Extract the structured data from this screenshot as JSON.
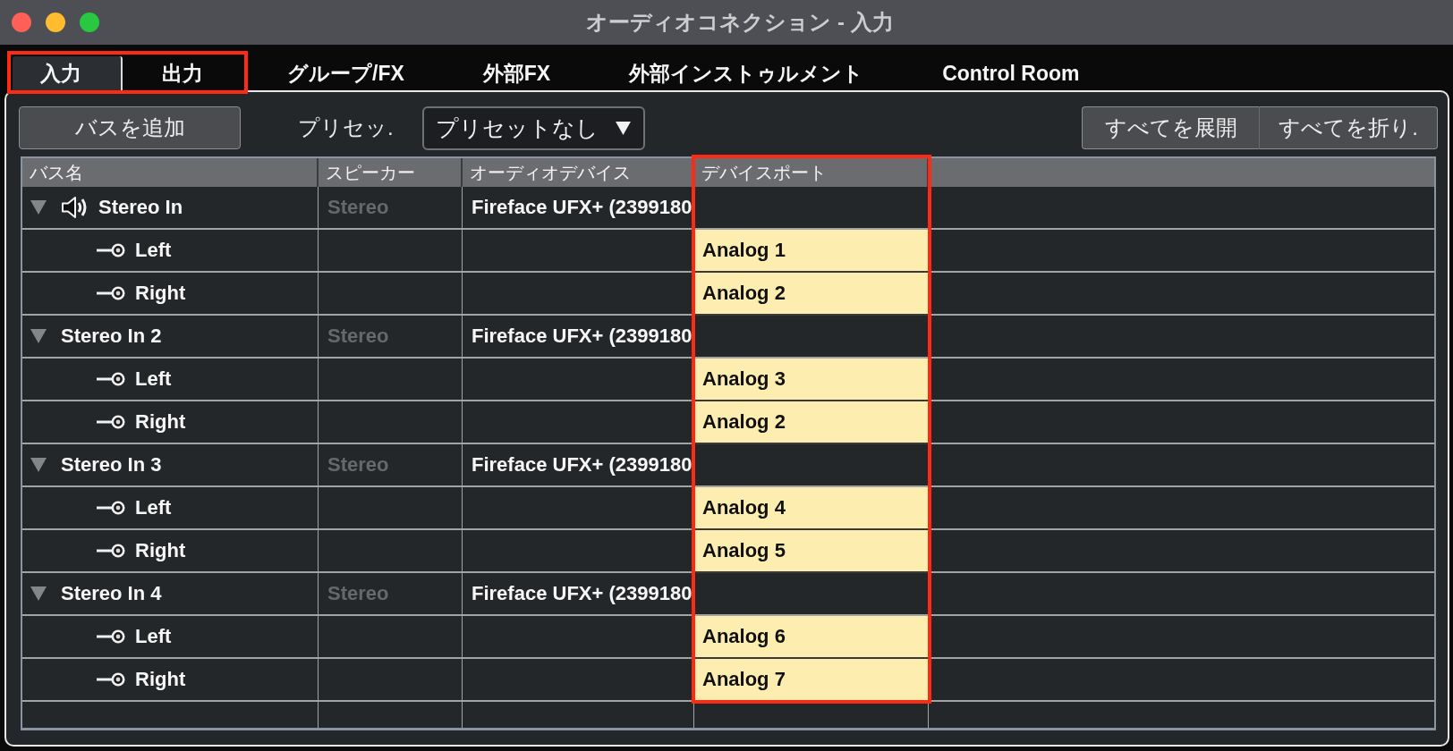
{
  "window": {
    "title": "オーディオコネクション - 入力"
  },
  "tabs": [
    {
      "label": "入力",
      "selected": true,
      "highlighted": true
    },
    {
      "label": "出力",
      "selected": false,
      "highlighted": true
    },
    {
      "label": "グループ/FX",
      "selected": false,
      "highlighted": false
    },
    {
      "label": "外部FX",
      "selected": false,
      "highlighted": false
    },
    {
      "label": "外部インストゥルメント",
      "selected": false,
      "highlighted": false
    },
    {
      "label": "Control Room",
      "selected": false,
      "highlighted": false
    }
  ],
  "toolbar": {
    "add_bus_button": "バスを追加",
    "preset_label": "プリセッ.",
    "preset_dropdown": "プリセットなし",
    "expand_all_button": "すべてを展開",
    "collapse_all_button": "すべてを折り."
  },
  "bus_table": {
    "columns": [
      {
        "label": "バス名",
        "highlighted": false
      },
      {
        "label": "スピーカー",
        "highlighted": false
      },
      {
        "label": "オーディオデバイス",
        "highlighted": false
      },
      {
        "label": "デバイスポート",
        "highlighted": true
      }
    ],
    "buses": [
      {
        "name": "Stereo In",
        "default_bus": true,
        "expanded": true,
        "speaker": "Stereo",
        "device": "Fireface UFX+ (2399180",
        "channels": [
          {
            "name": "Left",
            "port": "Analog 1"
          },
          {
            "name": "Right",
            "port": "Analog 2"
          }
        ]
      },
      {
        "name": "Stereo In 2",
        "default_bus": false,
        "expanded": true,
        "speaker": "Stereo",
        "device": "Fireface UFX+ (2399180",
        "channels": [
          {
            "name": "Left",
            "port": "Analog 3"
          },
          {
            "name": "Right",
            "port": "Analog 2"
          }
        ]
      },
      {
        "name": "Stereo In 3",
        "default_bus": false,
        "expanded": true,
        "speaker": "Stereo",
        "device": "Fireface UFX+ (2399180",
        "channels": [
          {
            "name": "Left",
            "port": "Analog 4"
          },
          {
            "name": "Right",
            "port": "Analog 5"
          }
        ]
      },
      {
        "name": "Stereo In 4",
        "default_bus": false,
        "expanded": true,
        "speaker": "Stereo",
        "device": "Fireface UFX+ (2399180",
        "channels": [
          {
            "name": "Left",
            "port": "Analog 6"
          },
          {
            "name": "Right",
            "port": "Analog 7"
          }
        ]
      }
    ]
  }
}
